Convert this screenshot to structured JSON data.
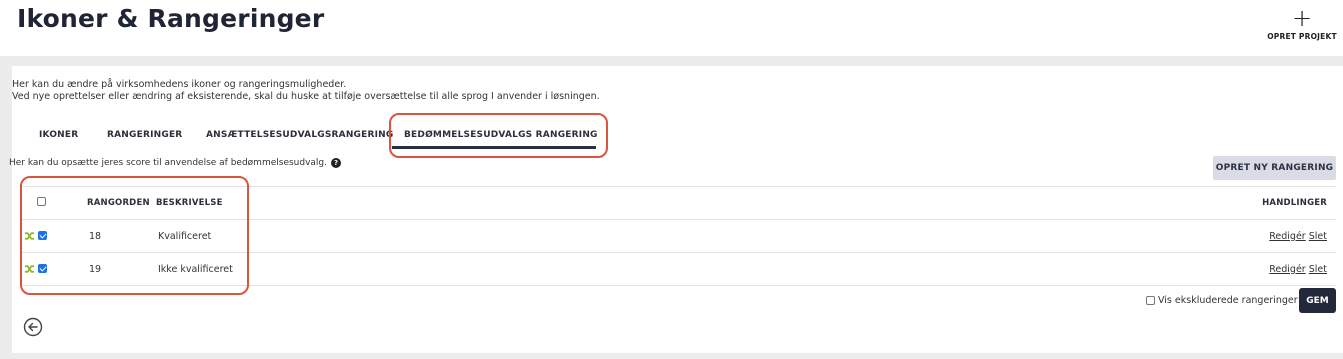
{
  "header": {
    "title": "Ikoner & Rangeringer",
    "create_project_label": "OPRET PROJEKT",
    "create_project_icon": "plus-icon"
  },
  "intro": {
    "line1": "Her kan du ændre på virksomhedens ikoner og rangeringsmuligheder.",
    "line2": "Ved nye oprettelser eller ændring af eksisterende, skal du huske at tilføje oversættelse til alle sprog I anvender i løsningen."
  },
  "tabs": [
    {
      "label": "IKONER",
      "active": false
    },
    {
      "label": "RANGERINGER",
      "active": false
    },
    {
      "label": "ANSÆTTELSESUDVALGSRANGERING",
      "active": false
    },
    {
      "label": "BEDØMMELSESUDVALGS RANGERING",
      "active": true
    }
  ],
  "section": {
    "description": "Her kan du opsætte jeres score til anvendelse af bedømmelsesudvalg.",
    "help_icon": "question-icon",
    "new_button_label": "OPRET NY RANGERING"
  },
  "table": {
    "columns": {
      "rank": "RANGORDEN",
      "description": "BESKRIVELSE",
      "actions": "HANDLINGER"
    },
    "rows": [
      {
        "rank": "18",
        "description": "Kvalificeret",
        "checked": true,
        "edit_label": "Redigér",
        "delete_label": "Slet"
      },
      {
        "rank": "19",
        "description": "Ikke kvalificeret",
        "checked": true,
        "edit_label": "Redigér",
        "delete_label": "Slet"
      }
    ]
  },
  "footer": {
    "show_excluded_label": "Vis ekskluderede rangeringer",
    "save_label": "GEM",
    "back_icon": "arrow-left-circle-icon"
  },
  "colors": {
    "highlight": "#d9553e",
    "dark": "#23283a",
    "checkbox": "#1a73e8",
    "shuffle": "#8ab52a"
  }
}
